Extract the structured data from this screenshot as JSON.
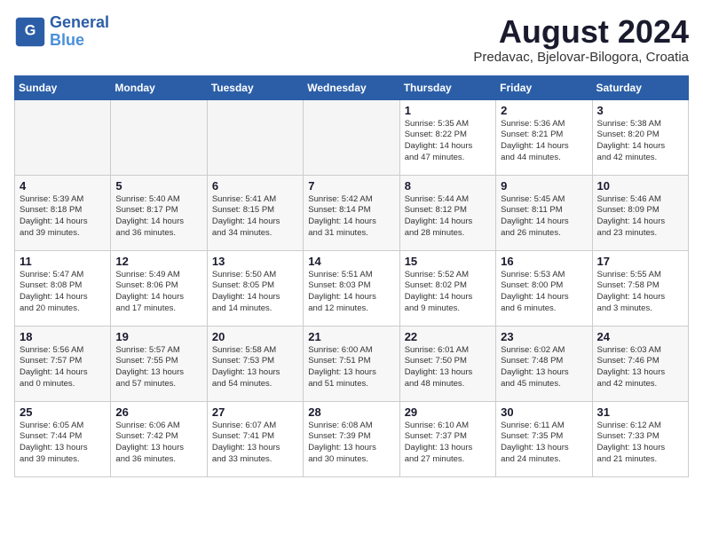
{
  "header": {
    "logo_line1": "General",
    "logo_line2": "Blue",
    "month_year": "August 2024",
    "location": "Predavac, Bjelovar-Bilogora, Croatia"
  },
  "days_of_week": [
    "Sunday",
    "Monday",
    "Tuesday",
    "Wednesday",
    "Thursday",
    "Friday",
    "Saturday"
  ],
  "weeks": [
    [
      {
        "day": "",
        "empty": true
      },
      {
        "day": "",
        "empty": true
      },
      {
        "day": "",
        "empty": true
      },
      {
        "day": "",
        "empty": true
      },
      {
        "day": "1",
        "lines": [
          "Sunrise: 5:35 AM",
          "Sunset: 8:22 PM",
          "Daylight: 14 hours",
          "and 47 minutes."
        ]
      },
      {
        "day": "2",
        "lines": [
          "Sunrise: 5:36 AM",
          "Sunset: 8:21 PM",
          "Daylight: 14 hours",
          "and 44 minutes."
        ]
      },
      {
        "day": "3",
        "lines": [
          "Sunrise: 5:38 AM",
          "Sunset: 8:20 PM",
          "Daylight: 14 hours",
          "and 42 minutes."
        ]
      }
    ],
    [
      {
        "day": "4",
        "lines": [
          "Sunrise: 5:39 AM",
          "Sunset: 8:18 PM",
          "Daylight: 14 hours",
          "and 39 minutes."
        ]
      },
      {
        "day": "5",
        "lines": [
          "Sunrise: 5:40 AM",
          "Sunset: 8:17 PM",
          "Daylight: 14 hours",
          "and 36 minutes."
        ]
      },
      {
        "day": "6",
        "lines": [
          "Sunrise: 5:41 AM",
          "Sunset: 8:15 PM",
          "Daylight: 14 hours",
          "and 34 minutes."
        ]
      },
      {
        "day": "7",
        "lines": [
          "Sunrise: 5:42 AM",
          "Sunset: 8:14 PM",
          "Daylight: 14 hours",
          "and 31 minutes."
        ]
      },
      {
        "day": "8",
        "lines": [
          "Sunrise: 5:44 AM",
          "Sunset: 8:12 PM",
          "Daylight: 14 hours",
          "and 28 minutes."
        ]
      },
      {
        "day": "9",
        "lines": [
          "Sunrise: 5:45 AM",
          "Sunset: 8:11 PM",
          "Daylight: 14 hours",
          "and 26 minutes."
        ]
      },
      {
        "day": "10",
        "lines": [
          "Sunrise: 5:46 AM",
          "Sunset: 8:09 PM",
          "Daylight: 14 hours",
          "and 23 minutes."
        ]
      }
    ],
    [
      {
        "day": "11",
        "lines": [
          "Sunrise: 5:47 AM",
          "Sunset: 8:08 PM",
          "Daylight: 14 hours",
          "and 20 minutes."
        ]
      },
      {
        "day": "12",
        "lines": [
          "Sunrise: 5:49 AM",
          "Sunset: 8:06 PM",
          "Daylight: 14 hours",
          "and 17 minutes."
        ]
      },
      {
        "day": "13",
        "lines": [
          "Sunrise: 5:50 AM",
          "Sunset: 8:05 PM",
          "Daylight: 14 hours",
          "and 14 minutes."
        ]
      },
      {
        "day": "14",
        "lines": [
          "Sunrise: 5:51 AM",
          "Sunset: 8:03 PM",
          "Daylight: 14 hours",
          "and 12 minutes."
        ]
      },
      {
        "day": "15",
        "lines": [
          "Sunrise: 5:52 AM",
          "Sunset: 8:02 PM",
          "Daylight: 14 hours",
          "and 9 minutes."
        ]
      },
      {
        "day": "16",
        "lines": [
          "Sunrise: 5:53 AM",
          "Sunset: 8:00 PM",
          "Daylight: 14 hours",
          "and 6 minutes."
        ]
      },
      {
        "day": "17",
        "lines": [
          "Sunrise: 5:55 AM",
          "Sunset: 7:58 PM",
          "Daylight: 14 hours",
          "and 3 minutes."
        ]
      }
    ],
    [
      {
        "day": "18",
        "lines": [
          "Sunrise: 5:56 AM",
          "Sunset: 7:57 PM",
          "Daylight: 14 hours",
          "and 0 minutes."
        ]
      },
      {
        "day": "19",
        "lines": [
          "Sunrise: 5:57 AM",
          "Sunset: 7:55 PM",
          "Daylight: 13 hours",
          "and 57 minutes."
        ]
      },
      {
        "day": "20",
        "lines": [
          "Sunrise: 5:58 AM",
          "Sunset: 7:53 PM",
          "Daylight: 13 hours",
          "and 54 minutes."
        ]
      },
      {
        "day": "21",
        "lines": [
          "Sunrise: 6:00 AM",
          "Sunset: 7:51 PM",
          "Daylight: 13 hours",
          "and 51 minutes."
        ]
      },
      {
        "day": "22",
        "lines": [
          "Sunrise: 6:01 AM",
          "Sunset: 7:50 PM",
          "Daylight: 13 hours",
          "and 48 minutes."
        ]
      },
      {
        "day": "23",
        "lines": [
          "Sunrise: 6:02 AM",
          "Sunset: 7:48 PM",
          "Daylight: 13 hours",
          "and 45 minutes."
        ]
      },
      {
        "day": "24",
        "lines": [
          "Sunrise: 6:03 AM",
          "Sunset: 7:46 PM",
          "Daylight: 13 hours",
          "and 42 minutes."
        ]
      }
    ],
    [
      {
        "day": "25",
        "lines": [
          "Sunrise: 6:05 AM",
          "Sunset: 7:44 PM",
          "Daylight: 13 hours",
          "and 39 minutes."
        ]
      },
      {
        "day": "26",
        "lines": [
          "Sunrise: 6:06 AM",
          "Sunset: 7:42 PM",
          "Daylight: 13 hours",
          "and 36 minutes."
        ]
      },
      {
        "day": "27",
        "lines": [
          "Sunrise: 6:07 AM",
          "Sunset: 7:41 PM",
          "Daylight: 13 hours",
          "and 33 minutes."
        ]
      },
      {
        "day": "28",
        "lines": [
          "Sunrise: 6:08 AM",
          "Sunset: 7:39 PM",
          "Daylight: 13 hours",
          "and 30 minutes."
        ]
      },
      {
        "day": "29",
        "lines": [
          "Sunrise: 6:10 AM",
          "Sunset: 7:37 PM",
          "Daylight: 13 hours",
          "and 27 minutes."
        ]
      },
      {
        "day": "30",
        "lines": [
          "Sunrise: 6:11 AM",
          "Sunset: 7:35 PM",
          "Daylight: 13 hours",
          "and 24 minutes."
        ]
      },
      {
        "day": "31",
        "lines": [
          "Sunrise: 6:12 AM",
          "Sunset: 7:33 PM",
          "Daylight: 13 hours",
          "and 21 minutes."
        ]
      }
    ]
  ]
}
